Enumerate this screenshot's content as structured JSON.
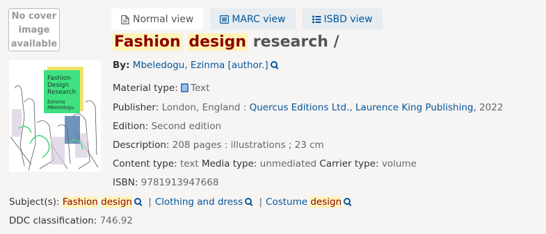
{
  "tabs": [
    {
      "label": "Normal view",
      "icon": "document-icon",
      "active": true
    },
    {
      "label": "MARC view",
      "icon": "list-box-icon",
      "active": false
    },
    {
      "label": "ISBD view",
      "icon": "list-icon",
      "active": false
    }
  ],
  "no_cover": {
    "line1": "No cover",
    "line2": "image",
    "line3": "available"
  },
  "cover": {
    "line1": "Fashion",
    "line2": "Design",
    "line3": "Research",
    "author1": "Ezinma",
    "author2": "Mbeledogu"
  },
  "title": {
    "word1": "Fashion",
    "word2": "design",
    "rest": "research /"
  },
  "by": {
    "label": "By:",
    "author": "Mbeledogu, Ezinma [author.]"
  },
  "material": {
    "label": "Material type:",
    "value": "Text"
  },
  "publisher": {
    "label": "Publisher:",
    "place": "London, England :",
    "pub1": "Quercus Editions Ltd.,",
    "pub2": "Laurence King Publishing,",
    "year": "2022"
  },
  "edition": {
    "label": "Edition:",
    "value": "Second edition"
  },
  "description": {
    "label": "Description:",
    "value": "208 pages : illustrations ; 23 cm"
  },
  "content": {
    "label": "Content type:",
    "value": "text",
    "media_label": "Media type:",
    "media_value": "unmediated",
    "carrier_label": "Carrier type:",
    "carrier_value": "volume"
  },
  "isbn": {
    "label": "ISBN:",
    "value": "9781913947668"
  },
  "subjects": {
    "label": "Subject(s):",
    "s1a": "Fashion",
    "s1b": "design",
    "s2": "Clothing and dress",
    "s3a": "Costume",
    "s3b": "design",
    "sep": "|"
  },
  "ddc": {
    "label": "DDC classification:",
    "value": "746.92"
  },
  "colors": {
    "link": "#00569b",
    "highlight_bg": "#fff3b6",
    "highlight_text": "#8b0000"
  }
}
